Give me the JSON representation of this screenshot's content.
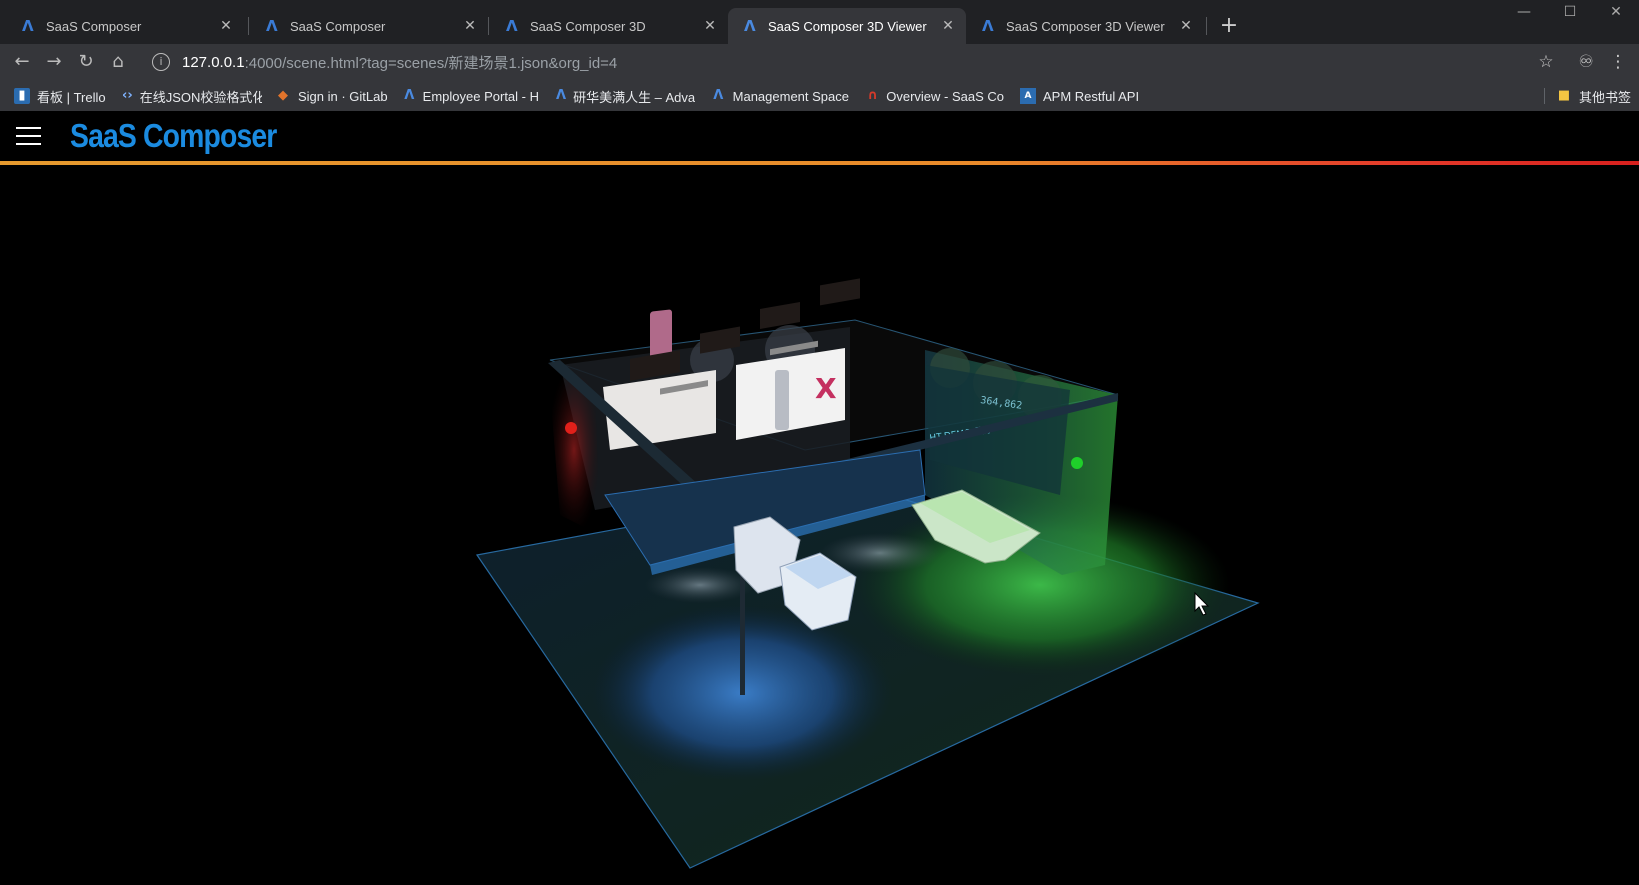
{
  "browser": {
    "tabs": [
      {
        "title": "SaaS Composer",
        "active": false
      },
      {
        "title": "SaaS Composer",
        "active": false
      },
      {
        "title": "SaaS Composer 3D",
        "active": false
      },
      {
        "title": "SaaS Composer 3D Viewer",
        "active": true
      },
      {
        "title": "SaaS Composer 3D Viewer",
        "active": false
      }
    ],
    "url_host": "127.0.0.1",
    "url_path": ":4000/scene.html?tag=scenes/新建场景1.json&org_id=4",
    "bookmarks": [
      {
        "label": "看板 | Trello",
        "icon": "trello-icon"
      },
      {
        "label": "在线JSON校验格式化",
        "icon": "code-icon"
      },
      {
        "label": "Sign in · GitLab",
        "icon": "gitlab-icon"
      },
      {
        "label": "Employee Portal - H",
        "icon": "advantech-icon"
      },
      {
        "label": "研华美满人生 – Adva",
        "icon": "advantech-icon"
      },
      {
        "label": "Management Space",
        "icon": "advantech-icon"
      },
      {
        "label": "Overview - SaaS Co",
        "icon": "saas-icon"
      },
      {
        "label": "APM Restful API",
        "icon": "api-icon"
      }
    ],
    "other_bookmarks": "其他书签"
  },
  "app": {
    "brand": "SaaS Composer"
  },
  "scene": {
    "wall_label": "HT-DEMO-展厅",
    "screen_number": "364,862",
    "accent_colors": {
      "red_light": "#e0201a",
      "green_light": "#1fcf2a",
      "blue_light": "#2a6bd8",
      "floor_edge": "#2a6fa8"
    }
  }
}
